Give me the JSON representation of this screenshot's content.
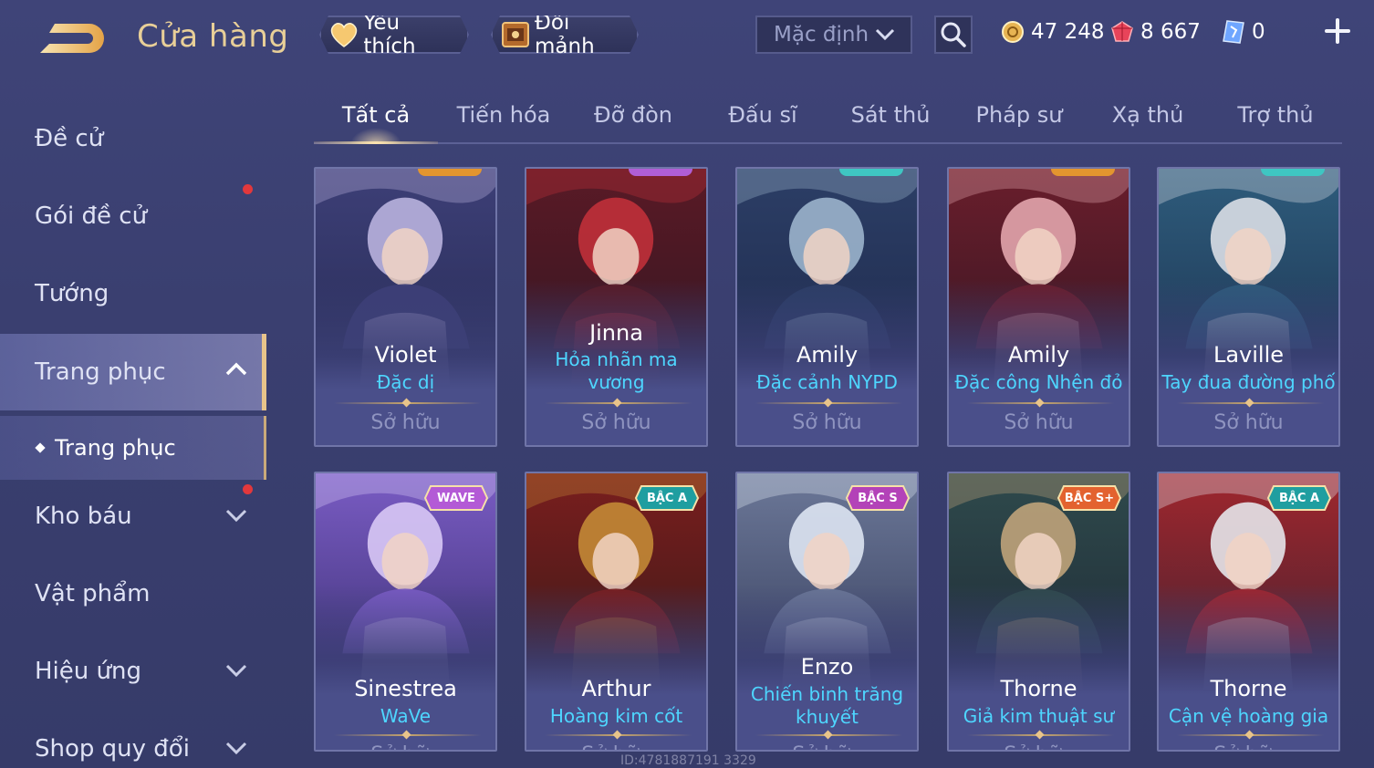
{
  "header": {
    "title": "Cửa hàng",
    "favorites_label": "Yêu thích",
    "exchange_label": "Đổi mảnh",
    "sort_value": "Mặc định",
    "currencies": [
      {
        "name": "gold",
        "value": "47 248",
        "color": "#e7b453"
      },
      {
        "name": "gem",
        "value": "8 667",
        "color": "#e8445a"
      },
      {
        "name": "ticket",
        "value": "0",
        "color": "#6fa6ff"
      }
    ]
  },
  "sidebar": {
    "items": [
      {
        "label": "Đề cử",
        "dot": false
      },
      {
        "label": "Gói đề cử",
        "dot": true
      },
      {
        "label": "Tướng",
        "dot": false
      },
      {
        "label": "Trang phục",
        "active": true
      },
      {
        "label": "Kho báu",
        "dot": true
      },
      {
        "label": "Vật phẩm"
      },
      {
        "label": "Hiệu ứng"
      },
      {
        "label": "Shop quy đổi"
      }
    ],
    "sub_item": "Trang phục"
  },
  "tabs": [
    "Tất cả",
    "Tiến hóa",
    "Đỡ đòn",
    "Đấu sĩ",
    "Sát thủ",
    "Pháp sư",
    "Xạ thủ",
    "Trợ thủ"
  ],
  "cards": [
    {
      "hero": "Violet",
      "skin": "Đặc dị",
      "status": "Sở hữu",
      "top_tag_color": "#e3952f",
      "art": [
        "#b9b2de",
        "#3d3f77",
        "#23284f"
      ]
    },
    {
      "hero": "Jinna",
      "skin_line1": "Hỏa nhãn ma",
      "skin_line2": "vương",
      "status": "Sở hữu",
      "top_tag_color": "#b05ed6",
      "art": [
        "#c0303a",
        "#5a1a26",
        "#2a1420"
      ]
    },
    {
      "hero": "Amily",
      "skin": "Đặc cảnh NYPD",
      "status": "Sở hữu",
      "top_tag_color": "#3fc6c2",
      "art": [
        "#9bb4cc",
        "#2c3e66",
        "#1b2646"
      ]
    },
    {
      "hero": "Amily",
      "skin": "Đặc công Nhện đỏ",
      "status": "Sở hữu",
      "top_tag_color": "#e3952f",
      "art": [
        "#e2a5ac",
        "#6a1e2c",
        "#2a1420"
      ]
    },
    {
      "hero": "Laville",
      "skin": "Tay đua đường phố",
      "status": "Sở hữu",
      "top_tag_color": "#3fc6c2",
      "art": [
        "#d9dee6",
        "#2e5c7c",
        "#1a2b48"
      ]
    },
    {
      "hero": "Sinestrea",
      "skin": "WaVe",
      "status": "Sở hữu",
      "badge": "WAVE",
      "badge_color": "#b35ad6",
      "art": [
        "#d8c8f5",
        "#7a5cc4",
        "#2d2660"
      ]
    },
    {
      "hero": "Arthur",
      "skin": "Hoàng kim cốt",
      "status": "Sở hữu",
      "badge": "BẬC A",
      "badge_color": "#1f9ea0",
      "art": [
        "#c38a36",
        "#7a1e1e",
        "#2a1816"
      ]
    },
    {
      "hero": "Enzo",
      "skin_line1": "Chiến binh trăng",
      "skin_line2": "khuyết",
      "status": "Sở hữu",
      "badge": "BẬC S",
      "badge_color": "#b342b8",
      "art": [
        "#dde4f2",
        "#6c7898",
        "#2a3150"
      ]
    },
    {
      "hero": "Thorne",
      "skin": "Giả kim thuật sư",
      "status": "Sở hữu",
      "badge": "BẬC S+",
      "badge_color": "#e3622f",
      "art": [
        "#bfa37a",
        "#2f4a4c",
        "#1a2230"
      ]
    },
    {
      "hero": "Thorne",
      "skin": "Cận vệ hoàng gia",
      "status": "Sở hữu",
      "badge": "BẬC A",
      "badge_color": "#1f9ea0",
      "art": [
        "#e5e6ea",
        "#a0262e",
        "#2c2230"
      ]
    }
  ],
  "watermark": "ID:4781887191 3329"
}
